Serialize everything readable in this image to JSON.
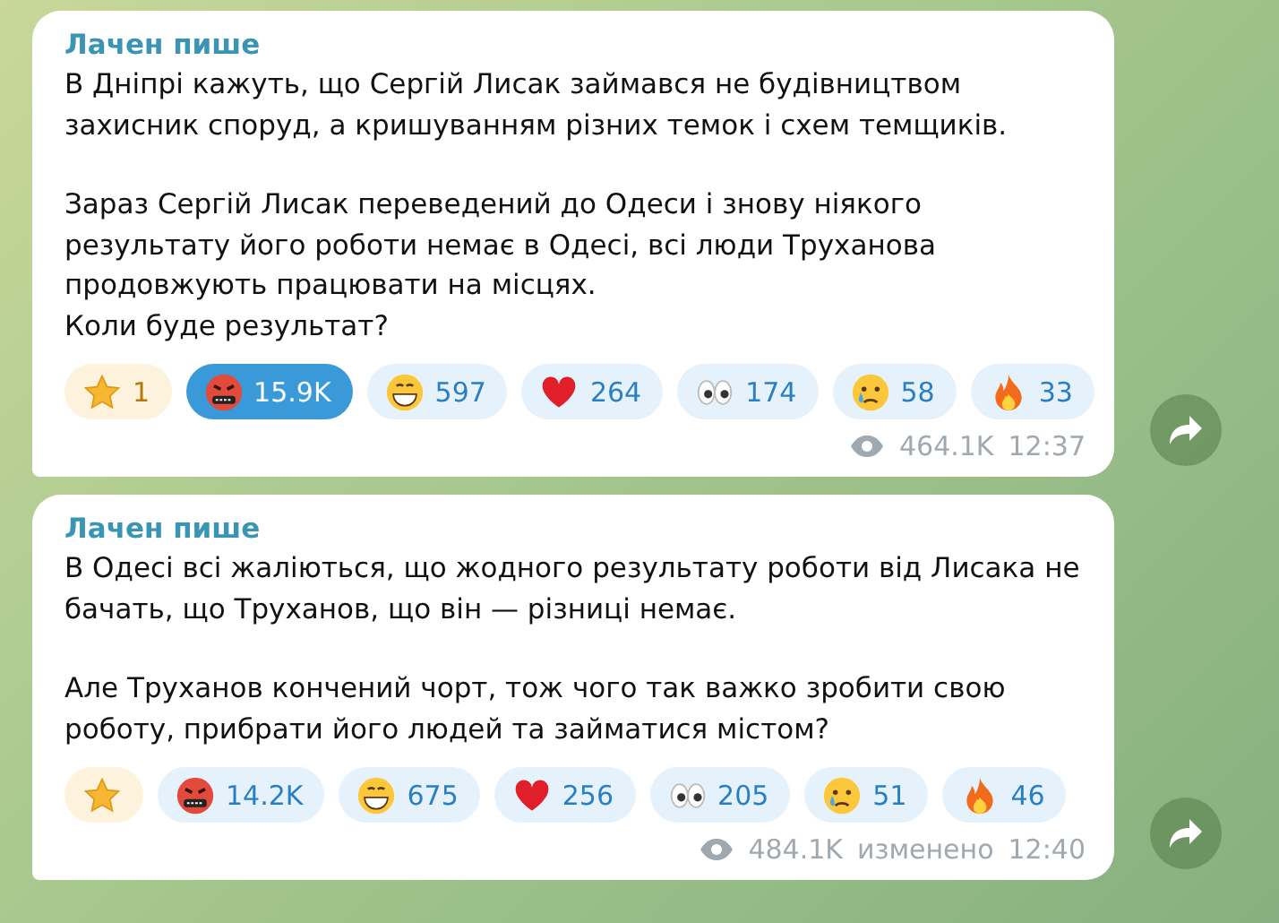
{
  "messages": [
    {
      "author": "Лачен пише",
      "paragraphs": [
        "В Дніпрі кажуть, що Сергій Лисак займався не будівництвом захисник споруд, а кришуванням різних темок і схем темщиків.",
        "Зараз Сергій Лисак переведений до Одеси і знову ніякого результату його роботи немає в Одесі, всі люди Труханова продовжують працювати на місцях.\nКоли буде результат?"
      ],
      "reactions": [
        {
          "kind": "star",
          "count": "1",
          "selected": false
        },
        {
          "kind": "swearing",
          "count": "15.9K",
          "selected": true
        },
        {
          "kind": "grin",
          "count": "597",
          "selected": false
        },
        {
          "kind": "heart",
          "count": "264",
          "selected": false
        },
        {
          "kind": "eyes",
          "count": "174",
          "selected": false
        },
        {
          "kind": "cry",
          "count": "58",
          "selected": false
        },
        {
          "kind": "fire",
          "count": "33",
          "selected": false
        }
      ],
      "views": "464.1K",
      "time": "12:37"
    },
    {
      "author": "Лачен пише",
      "paragraphs": [
        "В Одесі всі жаліються, що жодного результату роботи від Лисака не бачать, що Труханов, що він — різниці немає.",
        "Але Труханов кончений чорт, тож чого так важко зробити свою роботу, прибрати його людей та займатися містом?"
      ],
      "reactions": [
        {
          "kind": "star",
          "selected": false
        },
        {
          "kind": "swearing",
          "count": "14.2K",
          "selected": false
        },
        {
          "kind": "grin",
          "count": "675",
          "selected": false
        },
        {
          "kind": "heart",
          "count": "256",
          "selected": false
        },
        {
          "kind": "eyes",
          "count": "205",
          "selected": false
        },
        {
          "kind": "cry",
          "count": "51",
          "selected": false
        },
        {
          "kind": "fire",
          "count": "46",
          "selected": false
        }
      ],
      "views": "484.1K",
      "edited_label": "изменено",
      "time": "12:40"
    }
  ]
}
